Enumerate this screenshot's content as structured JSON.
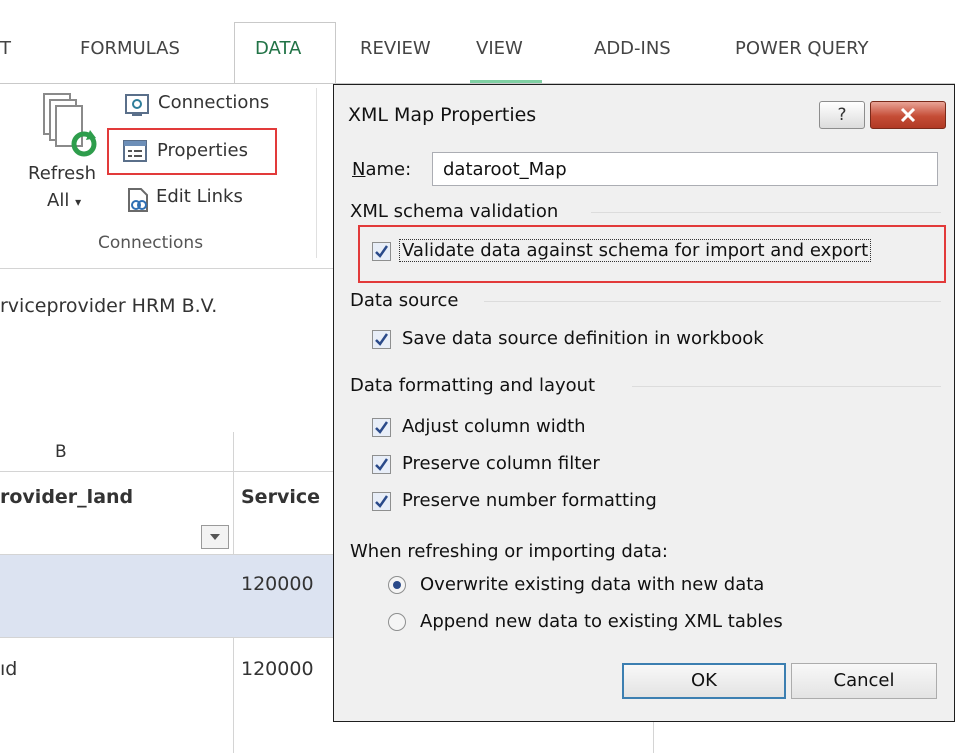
{
  "ribbon": {
    "tabs": [
      "T",
      "FORMULAS",
      "DATA",
      "REVIEW",
      "VIEW",
      "ADD-INS",
      "POWER QUERY"
    ],
    "active_tab": "DATA",
    "refresh_all_line1": "Refresh",
    "refresh_all_line2": "All",
    "connections_label": "Connections",
    "properties_label": "Properties",
    "edit_links_label": "Edit Links",
    "group_label": "Connections"
  },
  "sheet": {
    "company_text": "rviceprovider HRM B.V.",
    "column_b_header": "B",
    "col_header_provider_land": "rovider_land",
    "col_header_service": "Service",
    "row1_value": "120000",
    "row2_left": "ıd",
    "row2_value": "120000"
  },
  "dialog": {
    "title": "XML Map Properties",
    "help_label": "?",
    "name_label": "Name:",
    "name_value": "dataroot_Map",
    "schema_section": "XML schema validation",
    "validate_label": "Validate data against schema for import and export",
    "validate_checked": true,
    "data_source_section": "Data source",
    "save_definition_label": "Save data source definition in workbook",
    "save_definition_checked": true,
    "formatting_section": "Data formatting and layout",
    "adjust_width_label": "Adjust column width",
    "adjust_width_checked": true,
    "preserve_filter_label": "Preserve column filter",
    "preserve_filter_checked": true,
    "preserve_number_label": "Preserve number formatting",
    "preserve_number_checked": true,
    "refresh_question": "When refreshing or importing data:",
    "overwrite_label": "Overwrite existing data with new data",
    "overwrite_selected": true,
    "append_label": "Append new data to existing XML tables",
    "append_selected": false,
    "ok_label": "OK",
    "cancel_label": "Cancel"
  },
  "colors": {
    "accent_green": "#217346",
    "highlight_red": "#e23a3a",
    "selected_row": "#dce3f1",
    "close_button": "#c54d36"
  }
}
